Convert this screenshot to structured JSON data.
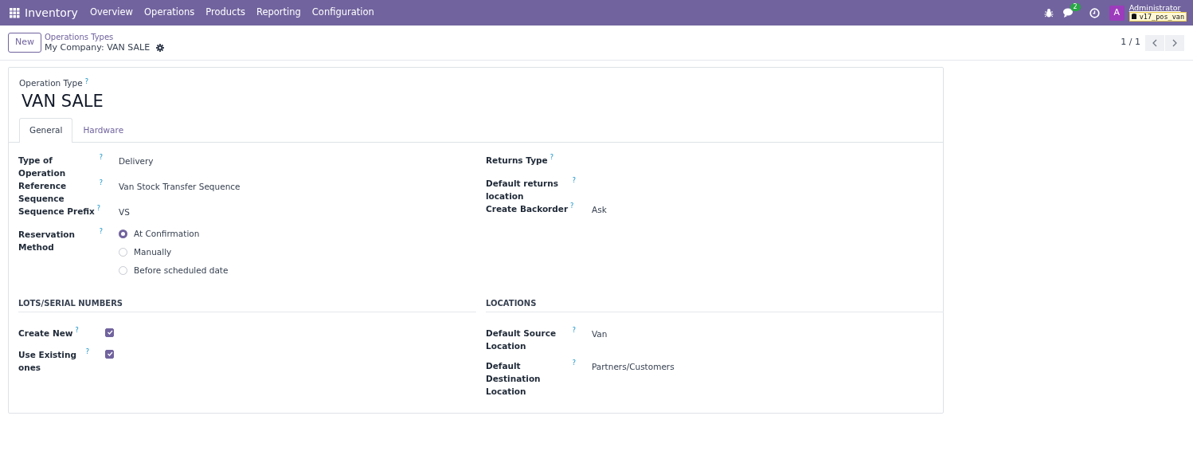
{
  "navbar": {
    "app_name": "Inventory",
    "menu": [
      "Overview",
      "Operations",
      "Products",
      "Reporting",
      "Configuration"
    ]
  },
  "systray": {
    "chat_count": "2",
    "user_initial": "A",
    "user_name": "Administrator",
    "database": "v17_pos_van"
  },
  "control_panel": {
    "new_button": "New",
    "breadcrumb_parent": "Operations Types",
    "breadcrumb_current": "My Company: VAN SALE",
    "pager": "1 / 1"
  },
  "form": {
    "title_label": "Operation Type",
    "title_help": "?",
    "title": "VAN SALE",
    "tabs": [
      {
        "label": "General",
        "selected": true
      },
      {
        "label": "Hardware",
        "selected": false
      }
    ],
    "columns": [
      {
        "fields": [
          {
            "kind": "text",
            "label": "Type of Operation",
            "help": "?",
            "value": "Delivery"
          },
          {
            "kind": "text",
            "label": "Reference Sequence",
            "help": "?",
            "value": "Van Stock Transfer Sequence"
          },
          {
            "kind": "text",
            "label": "Sequence Prefix",
            "help": "?",
            "value": "VS"
          },
          {
            "kind": "radio",
            "label": "Reservation Method",
            "help": "?",
            "options": [
              {
                "label": "At Confirmation",
                "selected": true
              },
              {
                "label": "Manually",
                "selected": false
              },
              {
                "label": "Before scheduled date",
                "selected": false
              }
            ]
          }
        ]
      },
      {
        "fields": [
          {
            "kind": "text",
            "label": "Returns Type",
            "help": "?"
          },
          {
            "kind": "text",
            "label": "Default returns location",
            "help": "?"
          },
          {
            "kind": "text",
            "label": "Create Backorder",
            "help": "?",
            "value": "Ask"
          }
        ]
      }
    ],
    "sections": [
      {
        "title": "LOTS/SERIAL NUMBERS",
        "fields": [
          {
            "kind": "checkbox",
            "label": "Create New",
            "help": "?",
            "checked": true
          },
          {
            "kind": "checkbox",
            "label": "Use Existing ones",
            "help": "?",
            "checked": true
          }
        ]
      },
      {
        "title": "LOCATIONS",
        "fields": [
          {
            "kind": "text",
            "label": "Default Source Location",
            "help": "?",
            "value": "Van"
          },
          {
            "kind": "text",
            "label": "Default Destination Location",
            "help": "?",
            "value": "Partners/Customers"
          }
        ]
      }
    ]
  }
}
